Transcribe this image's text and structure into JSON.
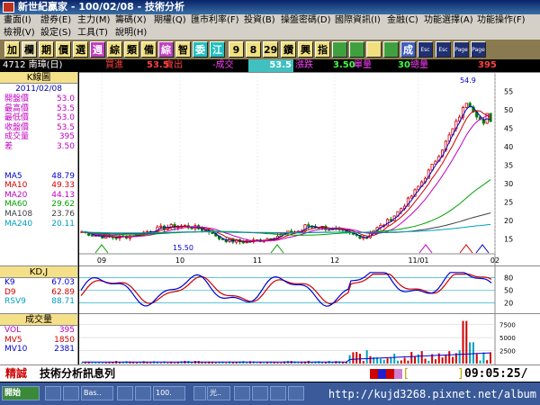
{
  "window": {
    "title": "新世紀贏家 - 100/02/08 - 技術分析"
  },
  "menus": {
    "row1": [
      "畫面(I)",
      "證券(E)",
      "主力(M)",
      "籌碼(X)",
      "期權(Q)",
      "匯市利率(F)",
      "投資(B)",
      "操盤密碼(D)",
      "國際資訊(I)",
      "金融(C)",
      "功能選擇(A)",
      "功能操作(F)"
    ],
    "row2": [
      "檢視(V)",
      "設定(S)",
      "工具(T)",
      "說明(H)"
    ]
  },
  "toolbar": {
    "buttons": [
      {
        "label": "加",
        "name": "toolbar-add-button"
      },
      {
        "label": "欄",
        "name": "toolbar-column-button"
      },
      {
        "label": "期",
        "name": "toolbar-futures-button"
      },
      {
        "label": "價",
        "name": "toolbar-price-button"
      },
      {
        "label": "選",
        "name": "toolbar-select-button"
      },
      {
        "label": "週",
        "name": "toolbar-week-button"
      },
      {
        "label": "綜",
        "name": "toolbar-summary-button"
      },
      {
        "label": "類",
        "name": "toolbar-category-button"
      },
      {
        "label": "備",
        "name": "toolbar-memo-button"
      },
      {
        "label": "綜",
        "name": "toolbar-summary2-button"
      },
      {
        "label": "智",
        "name": "toolbar-smart-button"
      },
      {
        "label": "委",
        "name": "toolbar-order-button"
      },
      {
        "label": "江",
        "name": "toolbar-jiang-button"
      },
      {
        "label": "9",
        "name": "toolbar-9-button"
      },
      {
        "label": "8",
        "name": "toolbar-8-button"
      },
      {
        "label": "29",
        "name": "toolbar-29-button"
      },
      {
        "label": "鑽",
        "name": "toolbar-diamond-button"
      },
      {
        "label": "興",
        "name": "toolbar-xing-button"
      },
      {
        "label": "指",
        "name": "toolbar-index-button"
      },
      {
        "label": "",
        "name": "toolbar-chart-icon-button"
      },
      {
        "label": "",
        "name": "toolbar-grid-icon-button"
      },
      {
        "label": "",
        "name": "toolbar-table-icon-button"
      },
      {
        "label": "",
        "name": "toolbar-stack-icon-button"
      },
      {
        "label": "成",
        "name": "toolbar-deal-button"
      },
      {
        "label": "Esc",
        "name": "toolbar-esc-button"
      },
      {
        "label": "Esc",
        "name": "toolbar-esc2-button"
      },
      {
        "label": "Page",
        "name": "toolbar-page-button"
      },
      {
        "label": "Page",
        "name": "toolbar-page2-button"
      }
    ],
    "colors": [
      "#f0e080",
      "#e8e0b0",
      "#f0e080",
      "#f0e080",
      "#f0e080",
      "#c040c0",
      "#f0e080",
      "#f0e080",
      "#f0e080",
      "#c040c0",
      "#f0e080",
      "#20c0c0",
      "#20c0c0",
      "#f0e080",
      "#f0e080",
      "#f0e080",
      "#f0e080",
      "#f0e080",
      "#f0e080",
      "#40a040",
      "#40a040",
      "#f0e080",
      "#40a040",
      "#4060c0",
      "#203070",
      "#203070",
      "#203070",
      "#203070"
    ]
  },
  "infostrip": {
    "stock": "4712 南璋(日)",
    "buy_label": "買進",
    "sell_value": "53.5",
    "sell_label": "賣出",
    "deal_label": "-成交",
    "deal_value": "53.5",
    "change_label": "漲跌",
    "change_value": "3.50",
    "volume_label": "單量",
    "total_value": "30",
    "total_label": "總量",
    "total_volume": "395"
  },
  "kline_panel": {
    "title": "K線圖",
    "date": "2011/02/08",
    "rows": [
      {
        "label": "開盤價",
        "value": "53.0",
        "color": "#c000c0"
      },
      {
        "label": "最高價",
        "value": "53.5",
        "color": "#c000c0"
      },
      {
        "label": "最低價",
        "value": "53.0",
        "color": "#c000c0"
      },
      {
        "label": "收盤價",
        "value": "53.5",
        "color": "#c000c0"
      },
      {
        "label": "成交量",
        "value": "395",
        "color": "#c000c0"
      },
      {
        "label": "差",
        "value": "3.50",
        "color": "#c000c0"
      }
    ],
    "ma": [
      {
        "label": "MA5",
        "value": "48.79",
        "color": "#0000d0"
      },
      {
        "label": "MA10",
        "value": "49.33",
        "color": "#d00000"
      },
      {
        "label": "MA20",
        "value": "44.13",
        "color": "#c000c0"
      },
      {
        "label": "MA60",
        "value": "29.62",
        "color": "#00a000"
      },
      {
        "label": "MA108",
        "value": "23.76",
        "color": "#404040"
      },
      {
        "label": "MA240",
        "value": "20.11",
        "color": "#00a0c0"
      }
    ]
  },
  "kd_panel": {
    "title": "KD,J",
    "rows": [
      {
        "label": "K9",
        "value": "67.03",
        "color": "#0000d0"
      },
      {
        "label": "D9",
        "value": "62.89",
        "color": "#d00000"
      },
      {
        "label": "RSV9",
        "value": "88.71",
        "color": "#00a0c0"
      }
    ]
  },
  "volume_panel": {
    "title": "成交量",
    "rows": [
      {
        "label": "VOL",
        "value": "395",
        "color": "#c000c0"
      },
      {
        "label": "MV5",
        "value": "1850",
        "color": "#d00000"
      },
      {
        "label": "MV10",
        "value": "2381",
        "color": "#0000d0"
      }
    ]
  },
  "chart_data": [
    {
      "type": "candlestick",
      "title": "K線圖",
      "x_ticks": [
        "09",
        "10",
        "11",
        "12",
        "11/01",
        "02"
      ],
      "y_ticks": [
        15,
        20,
        25,
        30,
        35,
        40,
        45,
        50,
        55
      ],
      "ylim": [
        12,
        58
      ],
      "annotations": [
        "54.9",
        "15.50"
      ],
      "ma_series": [
        "MA5",
        "MA10",
        "MA20",
        "MA60",
        "MA108",
        "MA240"
      ]
    },
    {
      "type": "line",
      "title": "KD,J",
      "y_ticks": [
        20,
        50,
        80
      ],
      "ylim": [
        0,
        100
      ],
      "series": [
        {
          "name": "K9"
        },
        {
          "name": "D9"
        }
      ]
    },
    {
      "type": "bar",
      "title": "成交量",
      "y_ticks": [
        2500,
        5000,
        7500
      ],
      "ylim": [
        0,
        9000
      ]
    }
  ],
  "status": {
    "badge": "精誠",
    "message": "技術分析訊息列",
    "time": "09:05:25/"
  },
  "taskbar": {
    "items": [
      "開始",
      "",
      "",
      "Bas..",
      "",
      "",
      "100.",
      "",
      "光..",
      "",
      "",
      "",
      ""
    ],
    "watermark": "http://kujd3268.pixnet.net/album"
  }
}
